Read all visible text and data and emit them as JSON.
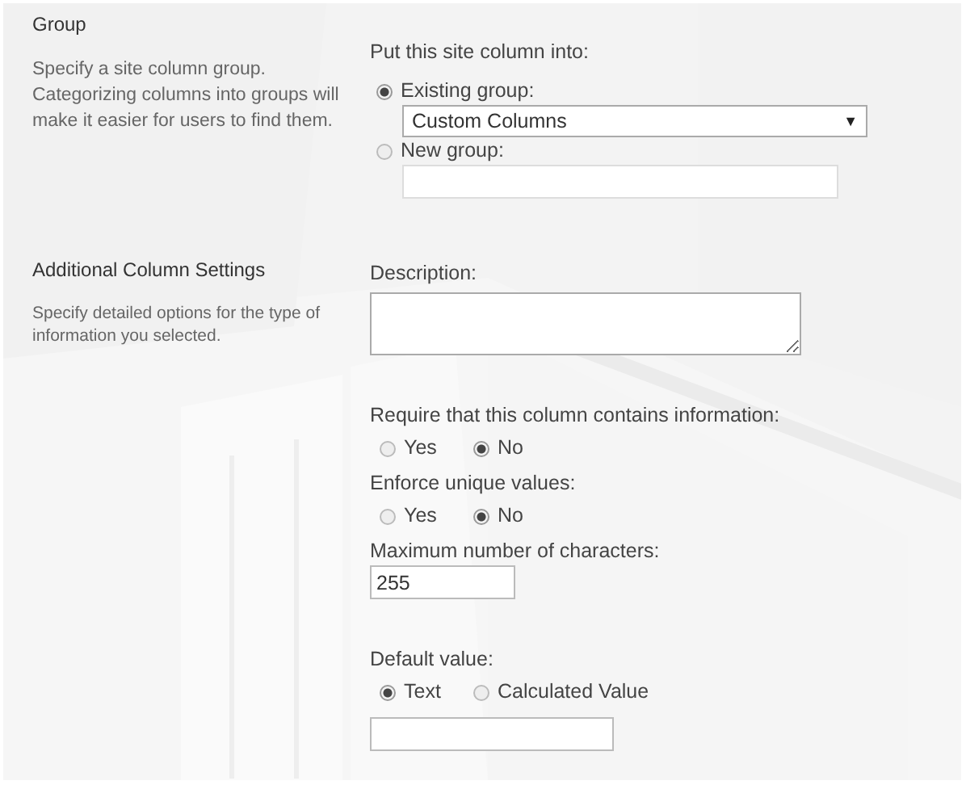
{
  "sections": [
    {
      "title": "Group",
      "description": "Specify a site column group. Categorizing columns into groups will make it easier for users to find them.",
      "items": [
        {
          "kind": "label",
          "text": "Put this site column into:"
        },
        {
          "kind": "radio",
          "label": "Existing group:",
          "selected": true
        },
        {
          "kind": "select",
          "value": "Custom Columns",
          "arrow": "▼"
        },
        {
          "kind": "radio",
          "label": "New group:",
          "selected": false
        },
        {
          "kind": "input_wide"
        }
      ]
    },
    {
      "title": "Additional Column Settings",
      "description": "Specify detailed options for the type of information you selected.",
      "items": [
        {
          "kind": "label",
          "text": "Description:"
        },
        {
          "kind": "textarea"
        },
        {
          "kind": "gap"
        },
        {
          "kind": "label",
          "text": "Require that this column contains information:"
        },
        {
          "kind": "radio_row",
          "options": [
            {
              "label": "Yes",
              "selected": false
            },
            {
              "label": "No",
              "selected": true
            }
          ]
        },
        {
          "kind": "label",
          "text": "Enforce unique values:"
        },
        {
          "kind": "radio_row",
          "options": [
            {
              "label": "Yes",
              "selected": false
            },
            {
              "label": "No",
              "selected": true
            }
          ]
        },
        {
          "kind": "label",
          "text": "Maximum number of characters:"
        },
        {
          "kind": "input_small",
          "value": "255"
        },
        {
          "kind": "gap"
        },
        {
          "kind": "label",
          "text": "Default value:"
        },
        {
          "kind": "radio_row",
          "options": [
            {
              "label": "Text",
              "selected": true
            },
            {
              "label": "Calculated Value",
              "selected": false
            }
          ]
        },
        {
          "kind": "input_medium"
        }
      ]
    }
  ]
}
